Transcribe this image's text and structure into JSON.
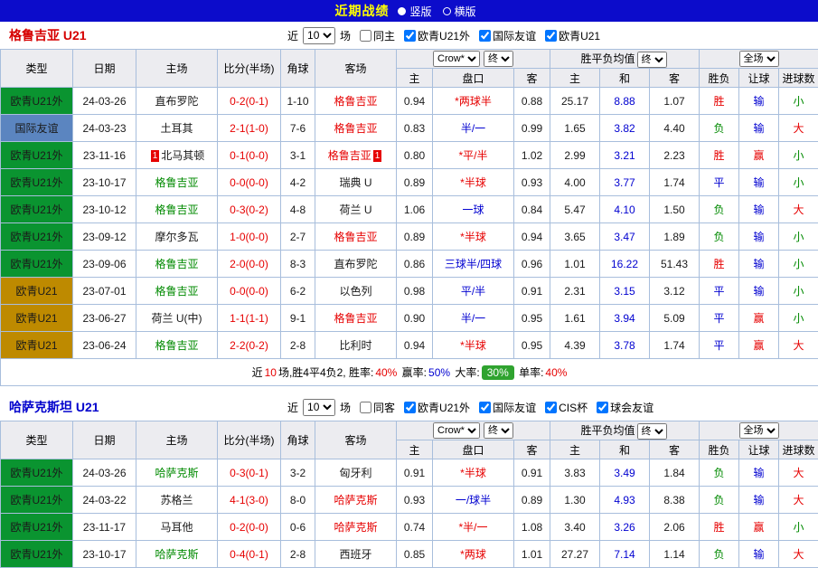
{
  "topbar": {
    "title": "近期战绩",
    "view_options": [
      {
        "label": "竖版",
        "selected": true
      },
      {
        "label": "横版",
        "selected": false
      }
    ]
  },
  "table_header": {
    "static_cols": [
      "类型",
      "日期",
      "主场",
      "比分(半场)",
      "角球",
      "客场"
    ],
    "odds_company_select": "Crow*",
    "odds_final_select": "终",
    "odds_sub": [
      "主",
      "盘口",
      "客"
    ],
    "avg_label": "胜平负均值",
    "avg_final_select": "终",
    "avg_sub": [
      "主",
      "和",
      "客"
    ],
    "scope_select": "全场",
    "result_sub": [
      "胜负",
      "让球",
      "进球数"
    ]
  },
  "sections": [
    {
      "title": "格鲁吉亚 U21",
      "title_color": "#D60000",
      "controls": {
        "near_label": "近",
        "count_value": "10",
        "games_label": "场",
        "checkboxes": [
          {
            "label": "同主",
            "checked": false
          },
          {
            "label": "欧青U21外",
            "checked": true
          },
          {
            "label": "国际友谊",
            "checked": true
          },
          {
            "label": "欧青U21",
            "checked": true
          }
        ]
      },
      "rows": [
        {
          "type": "欧青U21外",
          "type_bg": "#0A9430",
          "date": "24-03-26",
          "home": "直布罗陀",
          "home_color": "#1A1A1A",
          "home_badge": "",
          "score": "0-2(0-1)",
          "corner": "1-10",
          "away": "格鲁吉亚",
          "away_color": "#E60000",
          "away_badge": "",
          "odds_home": "0.94",
          "handicap": "*两球半",
          "handicap_color": "#E60000",
          "odds_away": "0.88",
          "avg_home": "25.17",
          "avg_draw": "8.88",
          "avg_away": "1.07",
          "results": [
            "胜",
            "输",
            "小"
          ],
          "result_colors": [
            "#E60000",
            "#0000D0",
            "#008A00"
          ]
        },
        {
          "type": "国际友谊",
          "type_bg": "#5B85C0",
          "date": "24-03-23",
          "home": "土耳其",
          "home_color": "#1A1A1A",
          "home_badge": "",
          "score": "2-1(1-0)",
          "corner": "7-6",
          "away": "格鲁吉亚",
          "away_color": "#E60000",
          "away_badge": "",
          "odds_home": "0.83",
          "handicap": "半/一",
          "handicap_color": "#0000D0",
          "odds_away": "0.99",
          "avg_home": "1.65",
          "avg_draw": "3.82",
          "avg_away": "4.40",
          "results": [
            "负",
            "输",
            "大"
          ],
          "result_colors": [
            "#008A00",
            "#0000D0",
            "#E60000"
          ]
        },
        {
          "type": "欧青U21外",
          "type_bg": "#0A9430",
          "date": "23-11-16",
          "home": "北马其顿",
          "home_color": "#1A1A1A",
          "home_badge": "1",
          "score": "0-1(0-0)",
          "corner": "3-1",
          "away": "格鲁吉亚",
          "away_color": "#E60000",
          "away_badge": "1",
          "odds_home": "0.80",
          "handicap": "*平/半",
          "handicap_color": "#E60000",
          "odds_away": "1.02",
          "avg_home": "2.99",
          "avg_draw": "3.21",
          "avg_away": "2.23",
          "results": [
            "胜",
            "赢",
            "小"
          ],
          "result_colors": [
            "#E60000",
            "#E60000",
            "#008A00"
          ]
        },
        {
          "type": "欧青U21外",
          "type_bg": "#0A9430",
          "date": "23-10-17",
          "home": "格鲁吉亚",
          "home_color": "#008A00",
          "home_badge": "",
          "score": "0-0(0-0)",
          "corner": "4-2",
          "away": "瑞典 U",
          "away_color": "#1A1A1A",
          "away_badge": "",
          "odds_home": "0.89",
          "handicap": "*半球",
          "handicap_color": "#E60000",
          "odds_away": "0.93",
          "avg_home": "4.00",
          "avg_draw": "3.77",
          "avg_away": "1.74",
          "results": [
            "平",
            "输",
            "小"
          ],
          "result_colors": [
            "#0000D0",
            "#0000D0",
            "#008A00"
          ]
        },
        {
          "type": "欧青U21外",
          "type_bg": "#0A9430",
          "date": "23-10-12",
          "home": "格鲁吉亚",
          "home_color": "#008A00",
          "home_badge": "",
          "score": "0-3(0-2)",
          "corner": "4-8",
          "away": "荷兰 U",
          "away_color": "#1A1A1A",
          "away_badge": "",
          "odds_home": "1.06",
          "handicap": "一球",
          "handicap_color": "#0000D0",
          "odds_away": "0.84",
          "avg_home": "5.47",
          "avg_draw": "4.10",
          "avg_away": "1.50",
          "results": [
            "负",
            "输",
            "大"
          ],
          "result_colors": [
            "#008A00",
            "#0000D0",
            "#E60000"
          ]
        },
        {
          "type": "欧青U21外",
          "type_bg": "#0A9430",
          "date": "23-09-12",
          "home": "摩尔多瓦",
          "home_color": "#1A1A1A",
          "home_badge": "",
          "score": "1-0(0-0)",
          "corner": "2-7",
          "away": "格鲁吉亚",
          "away_color": "#E60000",
          "away_badge": "",
          "odds_home": "0.89",
          "handicap": "*半球",
          "handicap_color": "#E60000",
          "odds_away": "0.94",
          "avg_home": "3.65",
          "avg_draw": "3.47",
          "avg_away": "1.89",
          "results": [
            "负",
            "输",
            "小"
          ],
          "result_colors": [
            "#008A00",
            "#0000D0",
            "#008A00"
          ]
        },
        {
          "type": "欧青U21外",
          "type_bg": "#0A9430",
          "date": "23-09-06",
          "home": "格鲁吉亚",
          "home_color": "#008A00",
          "home_badge": "",
          "score": "2-0(0-0)",
          "corner": "8-3",
          "away": "直布罗陀",
          "away_color": "#1A1A1A",
          "away_badge": "",
          "odds_home": "0.86",
          "handicap": "三球半/四球",
          "handicap_color": "#0000D0",
          "odds_away": "0.96",
          "avg_home": "1.01",
          "avg_draw": "16.22",
          "avg_away": "51.43",
          "results": [
            "胜",
            "输",
            "小"
          ],
          "result_colors": [
            "#E60000",
            "#0000D0",
            "#008A00"
          ]
        },
        {
          "type": "欧青U21",
          "type_bg": "#BE8A00",
          "date": "23-07-01",
          "home": "格鲁吉亚",
          "home_color": "#008A00",
          "home_badge": "",
          "score": "0-0(0-0)",
          "corner": "6-2",
          "away": "以色列",
          "away_color": "#1A1A1A",
          "away_badge": "",
          "odds_home": "0.98",
          "handicap": "平/半",
          "handicap_color": "#0000D0",
          "odds_away": "0.91",
          "avg_home": "2.31",
          "avg_draw": "3.15",
          "avg_away": "3.12",
          "results": [
            "平",
            "输",
            "小"
          ],
          "result_colors": [
            "#0000D0",
            "#0000D0",
            "#008A00"
          ]
        },
        {
          "type": "欧青U21",
          "type_bg": "#BE8A00",
          "date": "23-06-27",
          "home": "荷兰 U(中)",
          "home_color": "#1A1A1A",
          "home_badge": "",
          "score": "1-1(1-1)",
          "corner": "9-1",
          "away": "格鲁吉亚",
          "away_color": "#E60000",
          "away_badge": "",
          "odds_home": "0.90",
          "handicap": "半/一",
          "handicap_color": "#0000D0",
          "odds_away": "0.95",
          "avg_home": "1.61",
          "avg_draw": "3.94",
          "avg_away": "5.09",
          "results": [
            "平",
            "赢",
            "小"
          ],
          "result_colors": [
            "#0000D0",
            "#E60000",
            "#008A00"
          ]
        },
        {
          "type": "欧青U21",
          "type_bg": "#BE8A00",
          "date": "23-06-24",
          "home": "格鲁吉亚",
          "home_color": "#008A00",
          "home_badge": "",
          "score": "2-2(0-2)",
          "corner": "2-8",
          "away": "比利时",
          "away_color": "#1A1A1A",
          "away_badge": "",
          "odds_home": "0.94",
          "handicap": "*半球",
          "handicap_color": "#E60000",
          "odds_away": "0.95",
          "avg_home": "4.39",
          "avg_draw": "3.78",
          "avg_away": "1.74",
          "results": [
            "平",
            "赢",
            "大"
          ],
          "result_colors": [
            "#0000D0",
            "#E60000",
            "#E60000"
          ]
        }
      ],
      "summary": [
        {
          "text": "近",
          "color": "#000000"
        },
        {
          "text": "10",
          "color": "#E60000"
        },
        {
          "text": "场,胜4平4负2, 胜率:",
          "color": "#000000"
        },
        {
          "text": "40%",
          "color": "#E60000"
        },
        {
          "text": " 赢率:",
          "color": "#000000"
        },
        {
          "text": "50%",
          "color": "#0000D0"
        },
        {
          "text": " 大率:",
          "color": "#000000"
        },
        {
          "text": "30%",
          "color": "#FFFFFF",
          "badge_bg": "#2FA32F"
        },
        {
          "text": " 单率:",
          "color": "#000000"
        },
        {
          "text": "40%",
          "color": "#E60000"
        }
      ]
    },
    {
      "title": "哈萨克斯坦 U21",
      "title_color": "#0000CC",
      "controls": {
        "near_label": "近",
        "count_value": "10",
        "games_label": "场",
        "checkboxes": [
          {
            "label": "同客",
            "checked": false
          },
          {
            "label": "欧青U21外",
            "checked": true
          },
          {
            "label": "国际友谊",
            "checked": true
          },
          {
            "label": "CIS杯",
            "checked": true
          },
          {
            "label": "球会友谊",
            "checked": true
          }
        ]
      },
      "rows": [
        {
          "type": "欧青U21外",
          "type_bg": "#0A9430",
          "date": "24-03-26",
          "home": "哈萨克斯",
          "home_color": "#008A00",
          "home_badge": "",
          "score": "0-3(0-1)",
          "corner": "3-2",
          "away": "匈牙利",
          "away_color": "#1A1A1A",
          "away_badge": "",
          "odds_home": "0.91",
          "handicap": "*半球",
          "handicap_color": "#E60000",
          "odds_away": "0.91",
          "avg_home": "3.83",
          "avg_draw": "3.49",
          "avg_away": "1.84",
          "results": [
            "负",
            "输",
            "大"
          ],
          "result_colors": [
            "#008A00",
            "#0000D0",
            "#E60000"
          ]
        },
        {
          "type": "欧青U21外",
          "type_bg": "#0A9430",
          "date": "24-03-22",
          "home": "苏格兰",
          "home_color": "#1A1A1A",
          "home_badge": "",
          "score": "4-1(3-0)",
          "corner": "8-0",
          "away": "哈萨克斯",
          "away_color": "#E60000",
          "away_badge": "",
          "odds_home": "0.93",
          "handicap": "一/球半",
          "handicap_color": "#0000D0",
          "odds_away": "0.89",
          "avg_home": "1.30",
          "avg_draw": "4.93",
          "avg_away": "8.38",
          "results": [
            "负",
            "输",
            "大"
          ],
          "result_colors": [
            "#008A00",
            "#0000D0",
            "#E60000"
          ]
        },
        {
          "type": "欧青U21外",
          "type_bg": "#0A9430",
          "date": "23-11-17",
          "home": "马耳他",
          "home_color": "#1A1A1A",
          "home_badge": "",
          "score": "0-2(0-0)",
          "corner": "0-6",
          "away": "哈萨克斯",
          "away_color": "#E60000",
          "away_badge": "",
          "odds_home": "0.74",
          "handicap": "*半/一",
          "handicap_color": "#E60000",
          "odds_away": "1.08",
          "avg_home": "3.40",
          "avg_draw": "3.26",
          "avg_away": "2.06",
          "results": [
            "胜",
            "赢",
            "小"
          ],
          "result_colors": [
            "#E60000",
            "#E60000",
            "#008A00"
          ]
        },
        {
          "type": "欧青U21外",
          "type_bg": "#0A9430",
          "date": "23-10-17",
          "home": "哈萨克斯",
          "home_color": "#008A00",
          "home_badge": "",
          "score": "0-4(0-1)",
          "corner": "2-8",
          "away": "西班牙",
          "away_color": "#1A1A1A",
          "away_badge": "",
          "odds_home": "0.85",
          "handicap": "*两球",
          "handicap_color": "#E60000",
          "odds_away": "1.01",
          "avg_home": "27.27",
          "avg_draw": "7.14",
          "avg_away": "1.14",
          "results": [
            "负",
            "输",
            "大"
          ],
          "result_colors": [
            "#008A00",
            "#0000D0",
            "#E60000"
          ]
        }
      ],
      "summary": []
    }
  ]
}
